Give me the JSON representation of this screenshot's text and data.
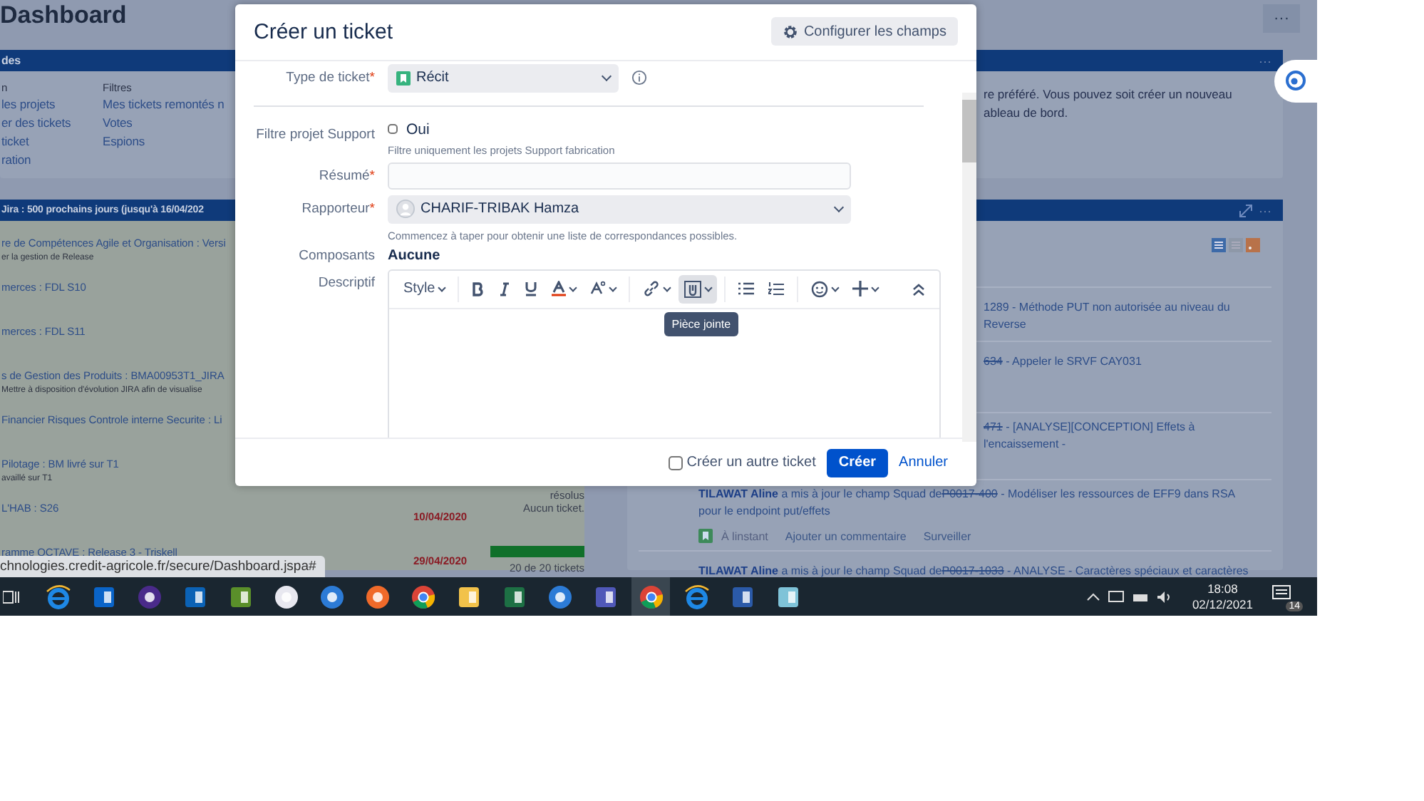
{
  "page": {
    "title": "Dashboard",
    "more": "···"
  },
  "shortcuts_gadget": {
    "title": "des",
    "columns": [
      {
        "heading": "n",
        "links": [
          "les projets",
          "er des tickets",
          "ticket",
          "ration"
        ]
      },
      {
        "heading": "Filtres",
        "links": [
          "Mes tickets remontés n",
          "Votes",
          "Espions"
        ]
      }
    ]
  },
  "versions_gadget": {
    "title": "Jira : 500 prochains jours (jusqu'à 16/04/202",
    "rows": [
      {
        "name": "re de Compétences Agile et Organisation : Versi",
        "description": "er la gestion de Release"
      },
      {
        "name": "merces : FDL S10"
      },
      {
        "name": "merces : FDL S11"
      },
      {
        "name": "s de Gestion des Produits : BMA00953T1_JIRA",
        "description": "Mettre à disposition d'évolution JIRA afin de visualise"
      },
      {
        "name": "Financier Risques Controle interne Securite : Li"
      },
      {
        "name": "Pilotage : BM livré sur T1",
        "description": "availlé sur T1",
        "status": "résolus"
      },
      {
        "name": "L'HAB : S26",
        "date": "10/04/2020",
        "status": "Aucun ticket."
      },
      {
        "name": "ramme OCTAVE : Release 3 - Triskell",
        "date": "29/04/2020",
        "level": 1,
        "status": "20 de 20 tickets"
      }
    ]
  },
  "intro_gadget": {
    "more": "···",
    "lines": [
      "re préféré. Vous pouvez soit créer un nouveau",
      "ableau de bord."
    ]
  },
  "activity_gadget": {
    "more": "···",
    "items": [
      {
        "key": "1289",
        "resolved": false,
        "summary": "- Méthode PUT non autorisée au niveau du Reverse"
      },
      {
        "key": "634",
        "resolved": true,
        "summary": "- Appeler le SRVF CAY031"
      },
      {
        "key": "471",
        "resolved": true,
        "summary": "- [ANALYSE][CONCEPTION] Effets à l'encaissement -"
      },
      {
        "author": "TILAWAT Aline",
        "action": "a mis à jour le champ Squad de",
        "key": "P0017-400",
        "resolved": true,
        "summary": "- Modéliser les ressources de EFF9 dans RSA pour le endpoint put/effets",
        "time": "À linstant",
        "actions": [
          "Ajouter un commentaire",
          "Surveiller"
        ]
      },
      {
        "author": "TILAWAT Aline",
        "action": "a mis à jour le champ Squad de",
        "key": "P0017-1033",
        "resolved": true,
        "summary": "- ANALYSE - Caractères spéciaux et caractères"
      }
    ]
  },
  "status_url": "chnologies.credit-agricole.fr/secure/Dashboard.jspa#",
  "dialog": {
    "title": "Créer un ticket",
    "configure_button": "Configurer les champs",
    "issue_type": {
      "label": "Type de ticket",
      "required_mark": "*",
      "value": "Récit"
    },
    "support_filter": {
      "label": "Filtre projet Support",
      "option": "Oui",
      "checked": false,
      "hint": "Filtre uniquement les projets Support fabrication"
    },
    "summary": {
      "label": "Résumé",
      "required_mark": "*"
    },
    "reporter": {
      "label": "Rapporteur",
      "required_mark": "*",
      "value": "CHARIF-TRIBAK Hamza",
      "hint": "Commencez à taper pour obtenir une liste de correspondances possibles."
    },
    "components": {
      "label": "Composants",
      "value": "Aucune"
    },
    "description": {
      "label": "Descriptif",
      "toolbar": [
        {
          "kind": "style",
          "label": "Style",
          "active": false
        },
        {
          "kind": "bold",
          "active": false
        },
        {
          "kind": "italic",
          "active": false
        },
        {
          "kind": "underline",
          "active": false
        },
        {
          "kind": "color",
          "active": false
        },
        {
          "kind": "format",
          "active": false
        },
        {
          "kind": "link",
          "active": false
        },
        {
          "kind": "attachment",
          "active": true
        },
        {
          "kind": "bullets",
          "active": false
        },
        {
          "kind": "numbers",
          "active": false
        },
        {
          "kind": "emoji",
          "active": false
        },
        {
          "kind": "insert",
          "active": false
        },
        {
          "kind": "collapse",
          "active": false
        }
      ],
      "tooltip": "Pièce jointe"
    },
    "create_another": {
      "label": "Créer un autre ticket",
      "checked": false
    },
    "submit": "Créer",
    "cancel": "Annuler"
  },
  "taskbar": {
    "apps": [
      {
        "kind": "ie",
        "selected": false
      },
      {
        "kind": "mail",
        "selected": false
      },
      {
        "kind": "cactus",
        "selected": false
      },
      {
        "kind": "lync",
        "selected": false
      },
      {
        "kind": "bulb",
        "selected": false
      },
      {
        "kind": "lock",
        "selected": false
      },
      {
        "kind": "chat",
        "selected": false
      },
      {
        "kind": "compass",
        "selected": false
      },
      {
        "kind": "chrome",
        "selected": false
      },
      {
        "kind": "folder",
        "selected": false
      },
      {
        "kind": "excel",
        "selected": false
      },
      {
        "kind": "chat",
        "selected": false
      },
      {
        "kind": "teams",
        "selected": false
      },
      {
        "kind": "chrome",
        "selected": true
      },
      {
        "kind": "ie",
        "selected": false
      },
      {
        "kind": "word",
        "selected": false
      },
      {
        "kind": "notepad",
        "selected": false
      }
    ],
    "time": "18:08",
    "date": "02/12/2021",
    "notifications": "14"
  }
}
